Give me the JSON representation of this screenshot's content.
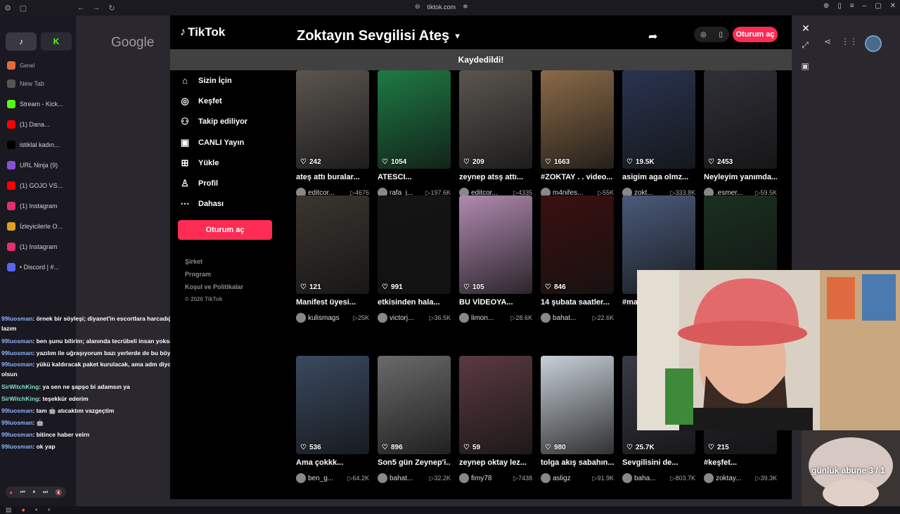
{
  "browser": {
    "url": "tiktok.com",
    "colors": {
      "accent": "#fe2c55",
      "bg": "#000000"
    }
  },
  "left_tabs": [
    {
      "label": "Genel",
      "icon": "folder-icon",
      "color": "#e26a3a",
      "kind": "small"
    },
    {
      "label": "New Tab",
      "icon": "plus-icon",
      "color": "#555555",
      "kind": "newtab"
    },
    {
      "label": "Stream - Kick...",
      "icon": "kick-icon",
      "color": "#53fc18",
      "kind": "tab"
    },
    {
      "label": "(1) Dana...",
      "icon": "youtube-icon",
      "color": "#ff0000",
      "kind": "tab"
    },
    {
      "label": "istiklal kadın...",
      "icon": "x-icon",
      "color": "#000000",
      "kind": "tab"
    },
    {
      "label": "URL Ninja (9)",
      "icon": "ninja-icon",
      "color": "#8a4fd8",
      "kind": "tab"
    },
    {
      "label": "(1) GOJO VS...",
      "icon": "youtube-icon",
      "color": "#ff0000",
      "kind": "tab"
    },
    {
      "label": "(1) Instagram",
      "icon": "instagram-icon",
      "color": "#e1306c",
      "kind": "tab"
    },
    {
      "label": "İzleyicilerle O...",
      "icon": "triangle-icon",
      "color": "#e0a020",
      "kind": "tab"
    },
    {
      "label": "(1) Instagram",
      "icon": "instagram-icon",
      "color": "#e1306c",
      "kind": "tab"
    },
    {
      "label": "• Discord | #...",
      "icon": "discord-icon",
      "color": "#5865f2",
      "kind": "tab"
    }
  ],
  "google": {
    "logo": "Google"
  },
  "tiktok": {
    "logo": "TikTok",
    "collection_title": "Zoktayın Sevgilisi Ateş",
    "toast": "Kaydedildi!",
    "login_label": "Oturum aç",
    "nav": [
      {
        "label": "Sizin İçin",
        "icon": "home-icon"
      },
      {
        "label": "Keşfet",
        "icon": "compass-icon"
      },
      {
        "label": "Takip ediliyor",
        "icon": "following-icon"
      },
      {
        "label": "CANLI Yayın",
        "icon": "live-icon"
      },
      {
        "label": "Yükle",
        "icon": "upload-icon"
      },
      {
        "label": "Profil",
        "icon": "profile-icon"
      },
      {
        "label": "Dahası",
        "icon": "more-icon"
      }
    ],
    "footer": [
      "Şirket",
      "Program",
      "Koşul ve Politikalar"
    ],
    "copyright": "© 2026 TikTok",
    "videos": [
      {
        "likes": "242",
        "title": "ateş attı buralar...",
        "user": "editcor...",
        "views": "4676",
        "color": "#5a5550"
      },
      {
        "likes": "1054",
        "title": "ATESCI...",
        "user": "rafa_j...",
        "views": "197.6K",
        "color": "#1e7a44"
      },
      {
        "likes": "209",
        "title": "zeynep atsş attı...",
        "user": "editcor...",
        "views": "4335",
        "color": "#5a5550"
      },
      {
        "likes": "1663",
        "title": "#ZOKTAY . . video...",
        "user": "m4nifes...",
        "views": "55K",
        "color": "#8a6a48"
      },
      {
        "likes": "19.5K",
        "title": "asigim aga olmz...",
        "user": "zokt...",
        "views": "333.8K",
        "color": "#2a3450"
      },
      {
        "likes": "2453",
        "title": "Neyleyim yanımda...",
        "user": ".esmer...",
        "views": "59.5K",
        "color": "#303038"
      },
      {
        "likes": "121",
        "title": "Manifest üyesi...",
        "user": "kulismags",
        "views": "25K",
        "color": "#3a3530"
      },
      {
        "likes": "991",
        "title": "etkisinden hala...",
        "user": "victorj...",
        "views": "36.5K",
        "color": "#141414"
      },
      {
        "likes": "105",
        "title": "BU VİDEOYA...",
        "user": "limon...",
        "views": "28.6K",
        "color": "#b08ab0"
      },
      {
        "likes": "846",
        "title": "14 şubata saatler...",
        "user": "bahat...",
        "views": "22.6K",
        "color": "#3a1010"
      },
      {
        "likes": "",
        "title": "#ma",
        "user": "",
        "views": "",
        "color": "#4a5a7a"
      },
      {
        "likes": "",
        "title": "",
        "user": "",
        "views": "",
        "color": "#1a3020"
      },
      {
        "likes": "536",
        "title": "Ama çokkk...",
        "user": "ben_g...",
        "views": "64.2K",
        "color": "#3a4a60"
      },
      {
        "likes": "896",
        "title": "Son5 gün Zeynep'i...",
        "user": "bahat...",
        "views": "32.2K",
        "color": "#6a6a6a"
      },
      {
        "likes": "59",
        "title": "zeynep oktay lez...",
        "user": "fimy78",
        "views": "7438",
        "color": "#5a3a40"
      },
      {
        "likes": "980",
        "title": "tolga akış sabahın...",
        "user": "asligz",
        "views": "91.9K",
        "color": "#c8d0d8"
      },
      {
        "likes": "25.7K",
        "title": "Sevgilisini de...",
        "user": "baha...",
        "views": "803.7K",
        "color": "#3a3a48"
      },
      {
        "likes": "215",
        "title": "#keşfet...",
        "user": "zoktay...",
        "views": "39.3K",
        "color": "#2a2a30"
      }
    ]
  },
  "overlay": {
    "cam_text": "günlük abune 3 / 1"
  },
  "chat": [
    {
      "user": "99luosman",
      "msg": ": örnek bir söyleşi; diyanet'in escortlara harcadığı paralar lazım",
      "g": false
    },
    {
      "user": "99luosman",
      "msg": ": ben şunu bilirim; alanında tecrübeli insan yoksa yönetir",
      "g": false
    },
    {
      "user": "99luosman",
      "msg": ": yazılım ile uğraşıyorum bazı yerlerde de bu böyle",
      "g": false
    },
    {
      "user": "99luosman",
      "msg": ": yükü kaldıracak paket kurulacak, ama adm diyor ki böy olsun",
      "g": false
    },
    {
      "user": "SirWitchKing",
      "msg": ": ya sen ne şapşo bi adamsın ya",
      "g": true
    },
    {
      "user": "SirWitchKing",
      "msg": ": teşekkür ederim",
      "g": true
    },
    {
      "user": "99luosman",
      "msg": ": tam 🤖 atıcaktım vazgeçtim",
      "g": false
    },
    {
      "user": "99luosman",
      "msg": ": 🤖",
      "g": false
    },
    {
      "user": "99luosman",
      "msg": ": bitince haber veirn",
      "g": false
    },
    {
      "user": "99luosman",
      "msg": ": ok yap",
      "g": false
    }
  ]
}
